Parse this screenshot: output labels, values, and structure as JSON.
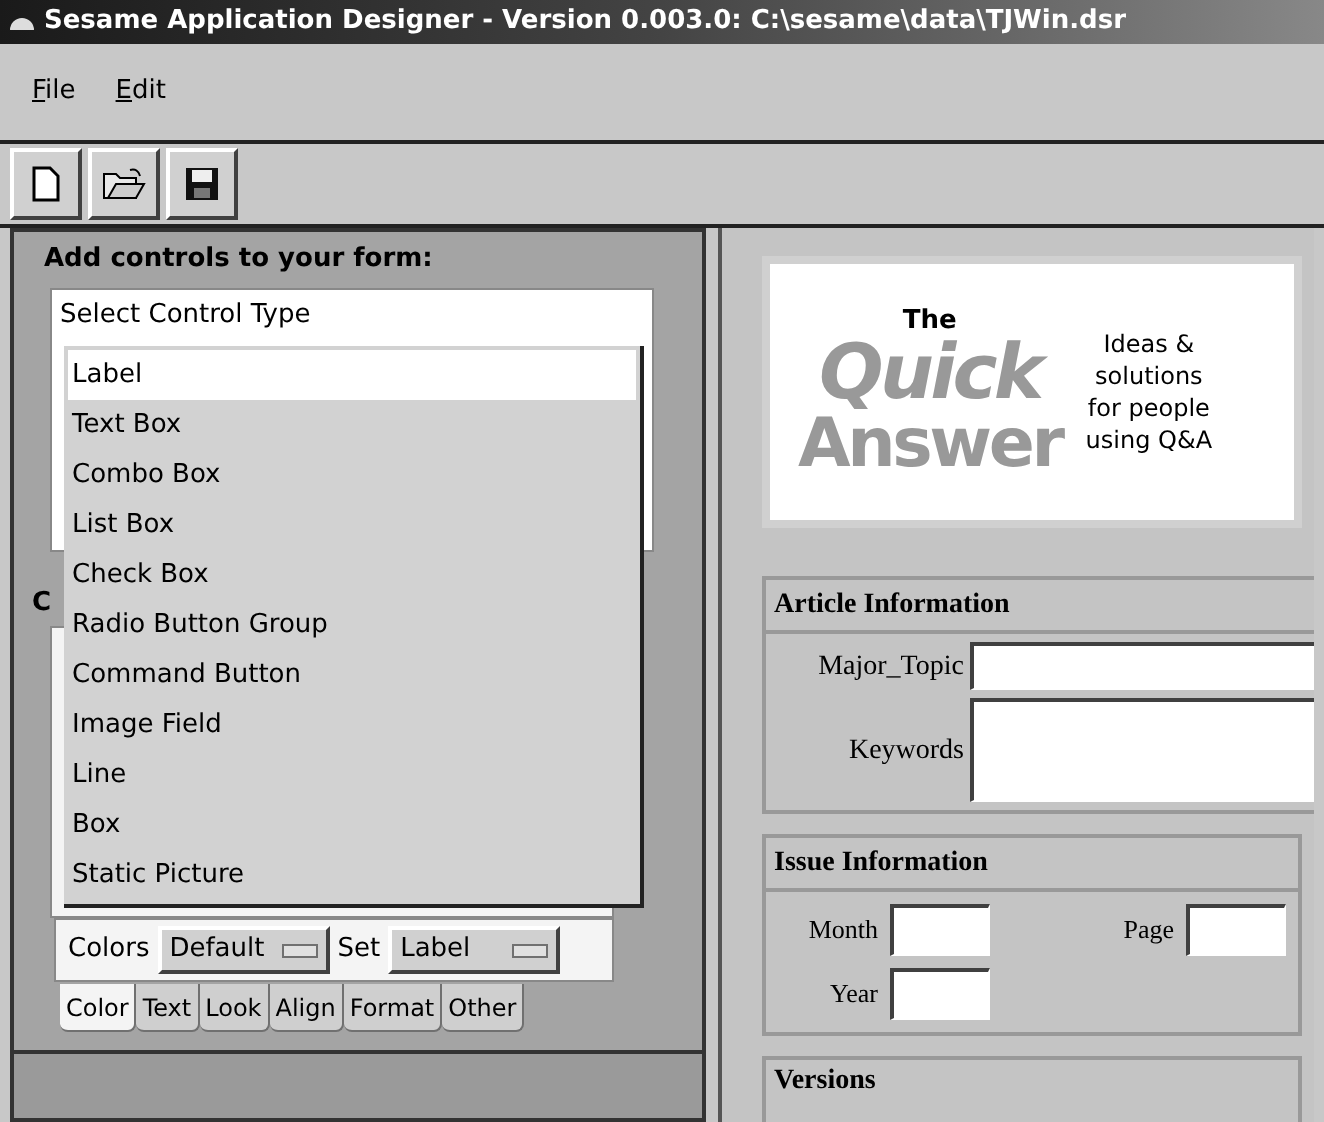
{
  "window": {
    "title": "Sesame Application Designer - Version 0.003.0: C:\\sesame\\data\\TJWin.dsr"
  },
  "menu": [
    {
      "label": "File"
    },
    {
      "label": "Edit"
    }
  ],
  "toolbar": [
    {
      "kind": "new"
    },
    {
      "kind": "open"
    },
    {
      "kind": "save"
    }
  ],
  "left_panel": {
    "heading": "Add controls to your form:",
    "combo": {
      "value": "Select Control Type"
    },
    "dropdown_items": [
      {
        "label": "Label",
        "selected": true
      },
      {
        "label": "Text Box",
        "selected": false
      },
      {
        "label": "Combo Box",
        "selected": false
      },
      {
        "label": "List Box",
        "selected": false
      },
      {
        "label": "Check Box",
        "selected": false
      },
      {
        "label": "Radio Button Group",
        "selected": false
      },
      {
        "label": "Command Button",
        "selected": false
      },
      {
        "label": "Image Field",
        "selected": false
      },
      {
        "label": "Line",
        "selected": false
      },
      {
        "label": "Box",
        "selected": false
      },
      {
        "label": "Static Picture",
        "selected": false
      }
    ],
    "hidden_label": "C",
    "colors_label": "Colors",
    "colors_value": "Default",
    "set_label": "Set",
    "set_value": "Label",
    "tabs": [
      {
        "label": "Color",
        "selected": true
      },
      {
        "label": "Text",
        "selected": false
      },
      {
        "label": "Look",
        "selected": false
      },
      {
        "label": "Align",
        "selected": false
      },
      {
        "label": "Format",
        "selected": false
      },
      {
        "label": "Other",
        "selected": false
      }
    ]
  },
  "form": {
    "logo": {
      "the": "The",
      "quick": "Quick",
      "answer": "Answer",
      "tagline": [
        "Ideas &",
        "solutions",
        "for people",
        "using Q&A"
      ]
    },
    "article": {
      "title": "Article Information",
      "fields": [
        {
          "label": "Major_Topic",
          "kind": "line"
        },
        {
          "label": "Keywords",
          "kind": "area"
        }
      ]
    },
    "issue": {
      "title": "Issue Information",
      "month": "Month",
      "page": "Page",
      "year": "Year"
    },
    "versions": {
      "title": "Versions"
    }
  }
}
